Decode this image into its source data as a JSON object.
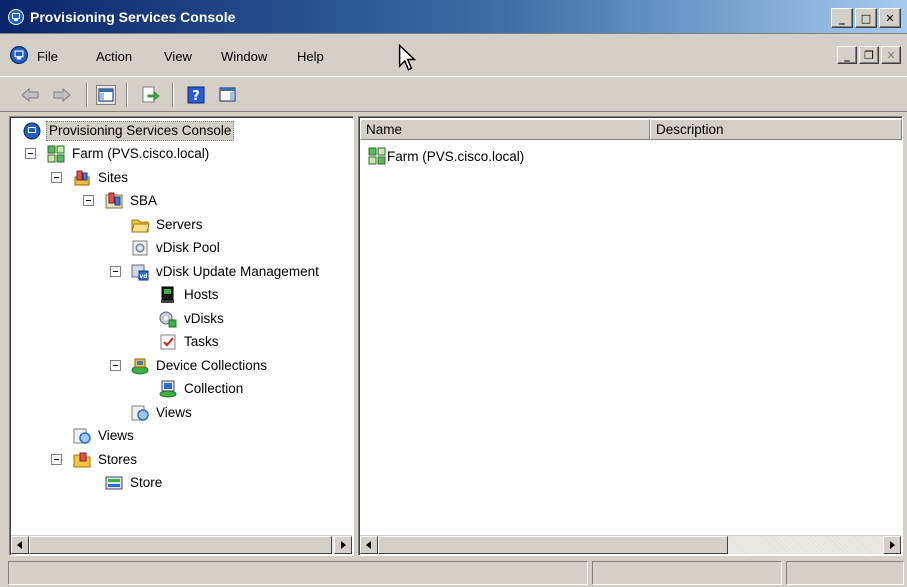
{
  "window": {
    "title": "Provisioning Services Console"
  },
  "title_buttons": [
    {
      "name": "minimize-button",
      "glyph": "_"
    },
    {
      "name": "maximize-button",
      "glyph": "□"
    },
    {
      "name": "close-button",
      "glyph": "✕"
    }
  ],
  "menu": {
    "file": "File",
    "action": "Action",
    "view": "View",
    "window": "Window",
    "help": "Help"
  },
  "mdi_buttons": [
    {
      "name": "child-minimize-button",
      "glyph": "_"
    },
    {
      "name": "child-restore-button",
      "glyph": "❐"
    },
    {
      "name": "child-close-button",
      "glyph": "✕"
    }
  ],
  "toolbar": [
    {
      "name": "back-icon"
    },
    {
      "name": "forward-icon"
    },
    {
      "name": "show-hide-tree-icon"
    },
    {
      "name": "export-list-icon"
    },
    {
      "name": "help-icon"
    },
    {
      "name": "show-hide-action-pane-icon"
    }
  ],
  "tree": {
    "root": "Provisioning Services Console",
    "farm": "Farm (PVS.cisco.local)",
    "sites": "Sites",
    "site_sba": "SBA",
    "servers": "Servers",
    "vdisk_pool": "vDisk Pool",
    "vdisk_update_mgmt": "vDisk Update Management",
    "hosts": "Hosts",
    "vdisks": "vDisks",
    "tasks": "Tasks",
    "device_collections": "Device Collections",
    "collection": "Collection",
    "site_views": "Views",
    "views": "Views",
    "stores": "Stores",
    "store": "Store"
  },
  "list": {
    "columns": [
      "Name",
      "Description"
    ],
    "rows": [
      {
        "name": "Farm (PVS.cisco.local)",
        "description": ""
      }
    ]
  },
  "colors": {
    "title_gradient_start": "#0a246a",
    "title_gradient_end": "#a6caf0",
    "chrome": "#d4d0c8"
  }
}
